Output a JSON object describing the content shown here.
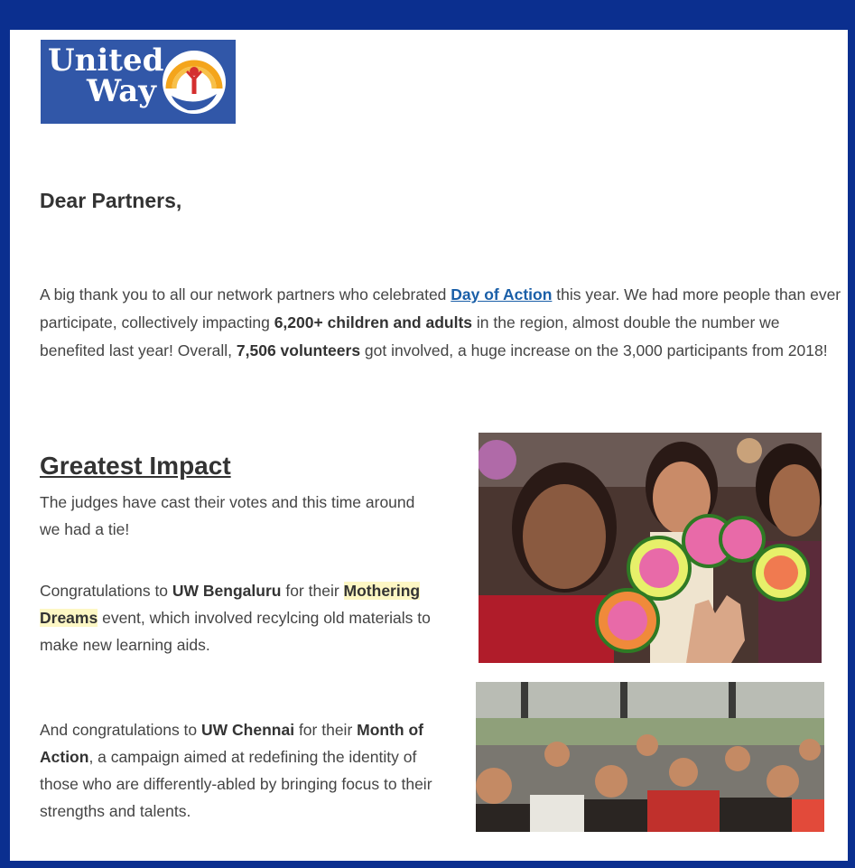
{
  "logo": {
    "line1": "United",
    "line2": "Way",
    "color": "#3157a8"
  },
  "greeting": "Dear Partners,",
  "intro": {
    "t1": "A big thank you to all our network partners who celebrated ",
    "link": "Day of Action",
    "t2": " this year. We had more people than ever participate, collectively impacting ",
    "b1": "6,200+ children and adults",
    "t3": " in the region, almost double the number we benefited last year! Overall, ",
    "b2": "7,506 volunteers",
    "t4": " got involved, a huge increase on the 3,000 participants from 2018!"
  },
  "section": {
    "title": "Greatest Impact",
    "p1": "The judges have cast their votes and this time around we had a tie!",
    "p2": {
      "t1": "Congratulations to ",
      "b1": "UW Bengaluru",
      "t2": " for their ",
      "hl1": "Mothering",
      "hl2": "Dreams",
      "t3": " event, which involved recylcing old materials to make new learning aids."
    },
    "p3": {
      "t1": "And congratulations to ",
      "b1": "UW Chennai",
      "t2": " for their ",
      "b2": "Month of Action",
      "t3": ", a campaign aimed at redefining the identity of those who are differently-abled by bringing focus to their strengths and talents."
    }
  },
  "colors": {
    "frame": "#0b2f8f",
    "link": "#1a5fa8",
    "highlight": "#fdf7c4"
  }
}
